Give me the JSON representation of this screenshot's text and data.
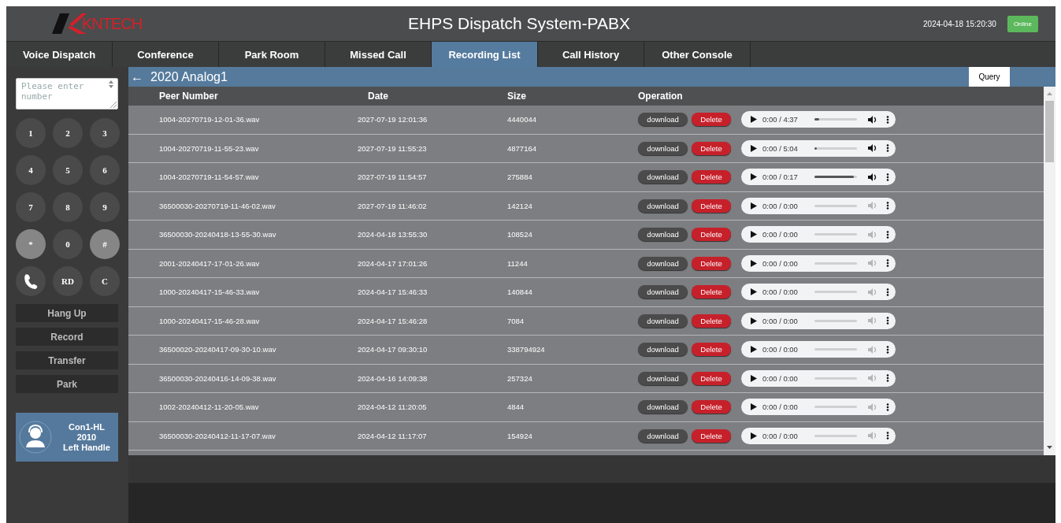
{
  "header": {
    "logo_text": "KNTECH",
    "title": "EHPS Dispatch System-PABX",
    "datetime": "2024-04-18 15:20:30",
    "status": "Online"
  },
  "tabs": [
    {
      "label": "Voice Dispatch",
      "selected": false
    },
    {
      "label": "Conference",
      "selected": false
    },
    {
      "label": "Park Room",
      "selected": false
    },
    {
      "label": "Missed Call",
      "selected": false
    },
    {
      "label": "Recording List",
      "selected": true
    },
    {
      "label": "Call History",
      "selected": false
    },
    {
      "label": "Other Console",
      "selected": false
    }
  ],
  "sidebar": {
    "number_field": {
      "placeholder": "Please enter number"
    },
    "keypad": [
      {
        "kind": "key",
        "label": "1",
        "highlighted": false
      },
      {
        "kind": "key",
        "label": "2",
        "highlighted": false
      },
      {
        "kind": "key",
        "label": "3",
        "highlighted": false
      },
      {
        "kind": "key",
        "label": "4",
        "highlighted": false
      },
      {
        "kind": "key",
        "label": "5",
        "highlighted": false
      },
      {
        "kind": "key",
        "label": "6",
        "highlighted": false
      },
      {
        "kind": "key",
        "label": "7",
        "highlighted": false
      },
      {
        "kind": "key",
        "label": "8",
        "highlighted": false
      },
      {
        "kind": "key",
        "label": "9",
        "highlighted": false
      },
      {
        "kind": "key",
        "label": "*",
        "highlighted": true
      },
      {
        "kind": "key",
        "label": "0",
        "highlighted": false
      },
      {
        "kind": "key",
        "label": "#",
        "highlighted": true
      },
      {
        "kind": "phone",
        "highlighted": false
      },
      {
        "kind": "key",
        "label": "RD",
        "highlighted": false
      },
      {
        "kind": "key",
        "label": "C",
        "highlighted": false
      }
    ],
    "actions": [
      "Hang Up",
      "Record",
      "Transfer",
      "Park"
    ],
    "agent": {
      "name": "Con1-HL",
      "extension": "2010",
      "handle": "Left Handle"
    }
  },
  "panel": {
    "back": "←",
    "title": "2020  Analog1",
    "query_button": "Query"
  },
  "table": {
    "columns": [
      "Peer Number",
      "Date",
      "Size",
      "Operation"
    ],
    "rows": [
      {
        "peer_number": "1004-20270719-12-01-36.wav",
        "date": "2027-07-19 12:01:36",
        "size": "4440044",
        "download": "download",
        "delete": "Delete",
        "player": {
          "time": "0:00 / 4:37",
          "level": 0.12,
          "enabled": true
        }
      },
      {
        "peer_number": "1004-20270719-11-55-23.wav",
        "date": "2027-07-19 11:55:23",
        "size": "4877164",
        "download": "download",
        "delete": "Delete",
        "player": {
          "time": "0:00 / 5:04",
          "level": 0.06,
          "enabled": true
        }
      },
      {
        "peer_number": "1004-20270719-11-54-57.wav",
        "date": "2027-07-19 11:54:57",
        "size": "275884",
        "download": "download",
        "delete": "Delete",
        "player": {
          "time": "0:00 / 0:17",
          "level": 0.92,
          "enabled": true
        }
      },
      {
        "peer_number": "36500030-20270719-11-46-02.wav",
        "date": "2027-07-19 11:46:02",
        "size": "142124",
        "download": "download",
        "delete": "Delete",
        "player": {
          "time": "0:00 / 0:00",
          "level": 0,
          "enabled": false
        }
      },
      {
        "peer_number": "36500030-20240418-13-55-30.wav",
        "date": "2024-04-18 13:55:30",
        "size": "108524",
        "download": "download",
        "delete": "Delete",
        "player": {
          "time": "0:00 / 0:00",
          "level": 0,
          "enabled": false
        }
      },
      {
        "peer_number": "2001-20240417-17-01-26.wav",
        "date": "2024-04-17 17:01:26",
        "size": "11244",
        "download": "download",
        "delete": "Delete",
        "player": {
          "time": "0:00 / 0:00",
          "level": 0,
          "enabled": false
        }
      },
      {
        "peer_number": "1000-20240417-15-46-33.wav",
        "date": "2024-04-17 15:46:33",
        "size": "140844",
        "download": "download",
        "delete": "Delete",
        "player": {
          "time": "0:00 / 0:00",
          "level": 0,
          "enabled": false
        }
      },
      {
        "peer_number": "1000-20240417-15-46-28.wav",
        "date": "2024-04-17 15:46:28",
        "size": "7084",
        "download": "download",
        "delete": "Delete",
        "player": {
          "time": "0:00 / 0:00",
          "level": 0,
          "enabled": false
        }
      },
      {
        "peer_number": "36500020-20240417-09-30-10.wav",
        "date": "2024-04-17 09:30:10",
        "size": "338794924",
        "download": "download",
        "delete": "Delete",
        "player": {
          "time": "0:00 / 0:00",
          "level": 0,
          "enabled": false
        }
      },
      {
        "peer_number": "36500030-20240416-14-09-38.wav",
        "date": "2024-04-16 14:09:38",
        "size": "257324",
        "download": "download",
        "delete": "Delete",
        "player": {
          "time": "0:00 / 0:00",
          "level": 0,
          "enabled": false
        }
      },
      {
        "peer_number": "1002-20240412-11-20-05.wav",
        "date": "2024-04-12 11:20:05",
        "size": "4844",
        "download": "download",
        "delete": "Delete",
        "player": {
          "time": "0:00 / 0:00",
          "level": 0,
          "enabled": false
        }
      },
      {
        "peer_number": "36500030-20240412-11-17-07.wav",
        "date": "2024-04-12 11:17:07",
        "size": "154924",
        "download": "download",
        "delete": "Delete",
        "player": {
          "time": "0:00 / 0:00",
          "level": 0,
          "enabled": false
        }
      }
    ]
  }
}
